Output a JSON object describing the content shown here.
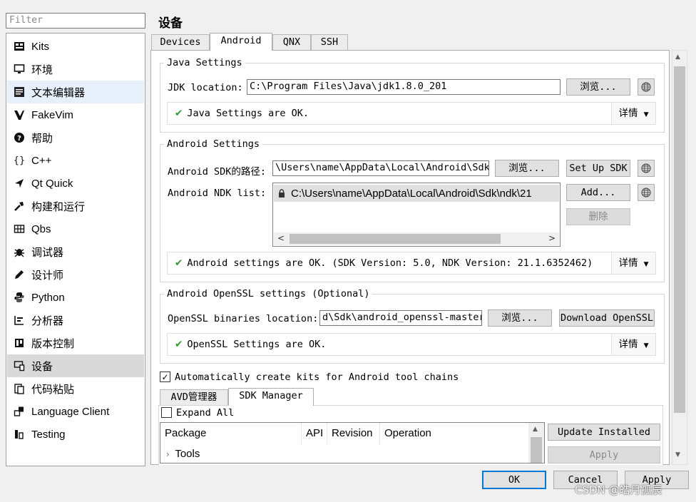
{
  "sidebar": {
    "filter_placeholder": "Filter",
    "items": [
      {
        "label": "Kits",
        "icon": "kits-icon"
      },
      {
        "label": "环境",
        "icon": "monitor-icon"
      },
      {
        "label": "文本编辑器",
        "icon": "text-editor-icon"
      },
      {
        "label": "FakeVim",
        "icon": "fakevim-icon"
      },
      {
        "label": "帮助",
        "icon": "help-icon"
      },
      {
        "label": "C++",
        "icon": "braces-icon"
      },
      {
        "label": "Qt Quick",
        "icon": "qtquick-icon"
      },
      {
        "label": "构建和运行",
        "icon": "hammer-icon"
      },
      {
        "label": "Qbs",
        "icon": "qbs-icon"
      },
      {
        "label": "调试器",
        "icon": "bug-icon"
      },
      {
        "label": "设计师",
        "icon": "pen-icon"
      },
      {
        "label": "Python",
        "icon": "python-icon"
      },
      {
        "label": "分析器",
        "icon": "analyzer-icon"
      },
      {
        "label": "版本控制",
        "icon": "version-control-icon"
      },
      {
        "label": "设备",
        "icon": "device-icon"
      },
      {
        "label": "代码粘贴",
        "icon": "paste-icon"
      },
      {
        "label": "Language Client",
        "icon": "language-client-icon"
      },
      {
        "label": "Testing",
        "icon": "testing-icon"
      }
    ],
    "selected": "设备",
    "hovered": "文本编辑器"
  },
  "page": {
    "title": "设备",
    "tabs": [
      {
        "label": "Devices"
      },
      {
        "label": "Android"
      },
      {
        "label": "QNX"
      },
      {
        "label": "SSH"
      }
    ],
    "active_tab": "Android"
  },
  "java": {
    "title": "Java Settings",
    "jdk_label": "JDK location:",
    "jdk_value": "C:\\Program Files\\Java\\jdk1.8.0_201",
    "browse": "浏览...",
    "status": "Java Settings are OK.",
    "details": "详情"
  },
  "android": {
    "title": "Android Settings",
    "sdk_label": "Android SDK的路径:",
    "sdk_value": "\\Users\\name\\AppData\\Local\\Android\\Sdk",
    "browse": "浏览...",
    "setup_sdk": "Set Up SDK",
    "ndk_label": "Android NDK list:",
    "ndk_items": [
      "C:\\Users\\name\\AppData\\Local\\Android\\Sdk\\ndk\\21"
    ],
    "add": "Add...",
    "remove": "删除",
    "status": "Android settings are OK. (SDK Version: 5.0, NDK Version: 21.1.6352462)",
    "details": "详情"
  },
  "openssl": {
    "title": "Android OpenSSL settings (Optional)",
    "location_label": "OpenSSL binaries location:",
    "location_value": "d\\Sdk\\android_openssl-master",
    "browse": "浏览...",
    "download": "Download OpenSSL",
    "status": "OpenSSL Settings are OK.",
    "details": "详情"
  },
  "auto_create_kits": {
    "label": "Automatically create kits for Android tool chains",
    "checked": true
  },
  "sdk_manager": {
    "tabs": [
      {
        "label": "AVD管理器"
      },
      {
        "label": "SDK Manager"
      }
    ],
    "active_tab": "SDK Manager",
    "expand_all": {
      "label": "Expand All",
      "checked": false
    },
    "columns": [
      "Package",
      "API",
      "Revision",
      "Operation"
    ],
    "rows": [
      {
        "package": "Tools"
      }
    ],
    "update_installed": "Update Installed",
    "apply": "Apply"
  },
  "dialog": {
    "ok": "OK",
    "cancel": "Cancel",
    "apply": "Apply"
  },
  "watermark": "CSDN @皓月孤辰",
  "colors": {
    "selected_item": "#d9d9d9",
    "hover_item": "#e5f0fb",
    "ok_check": "#2c9b2c",
    "default_button_border": "#0078d7"
  }
}
